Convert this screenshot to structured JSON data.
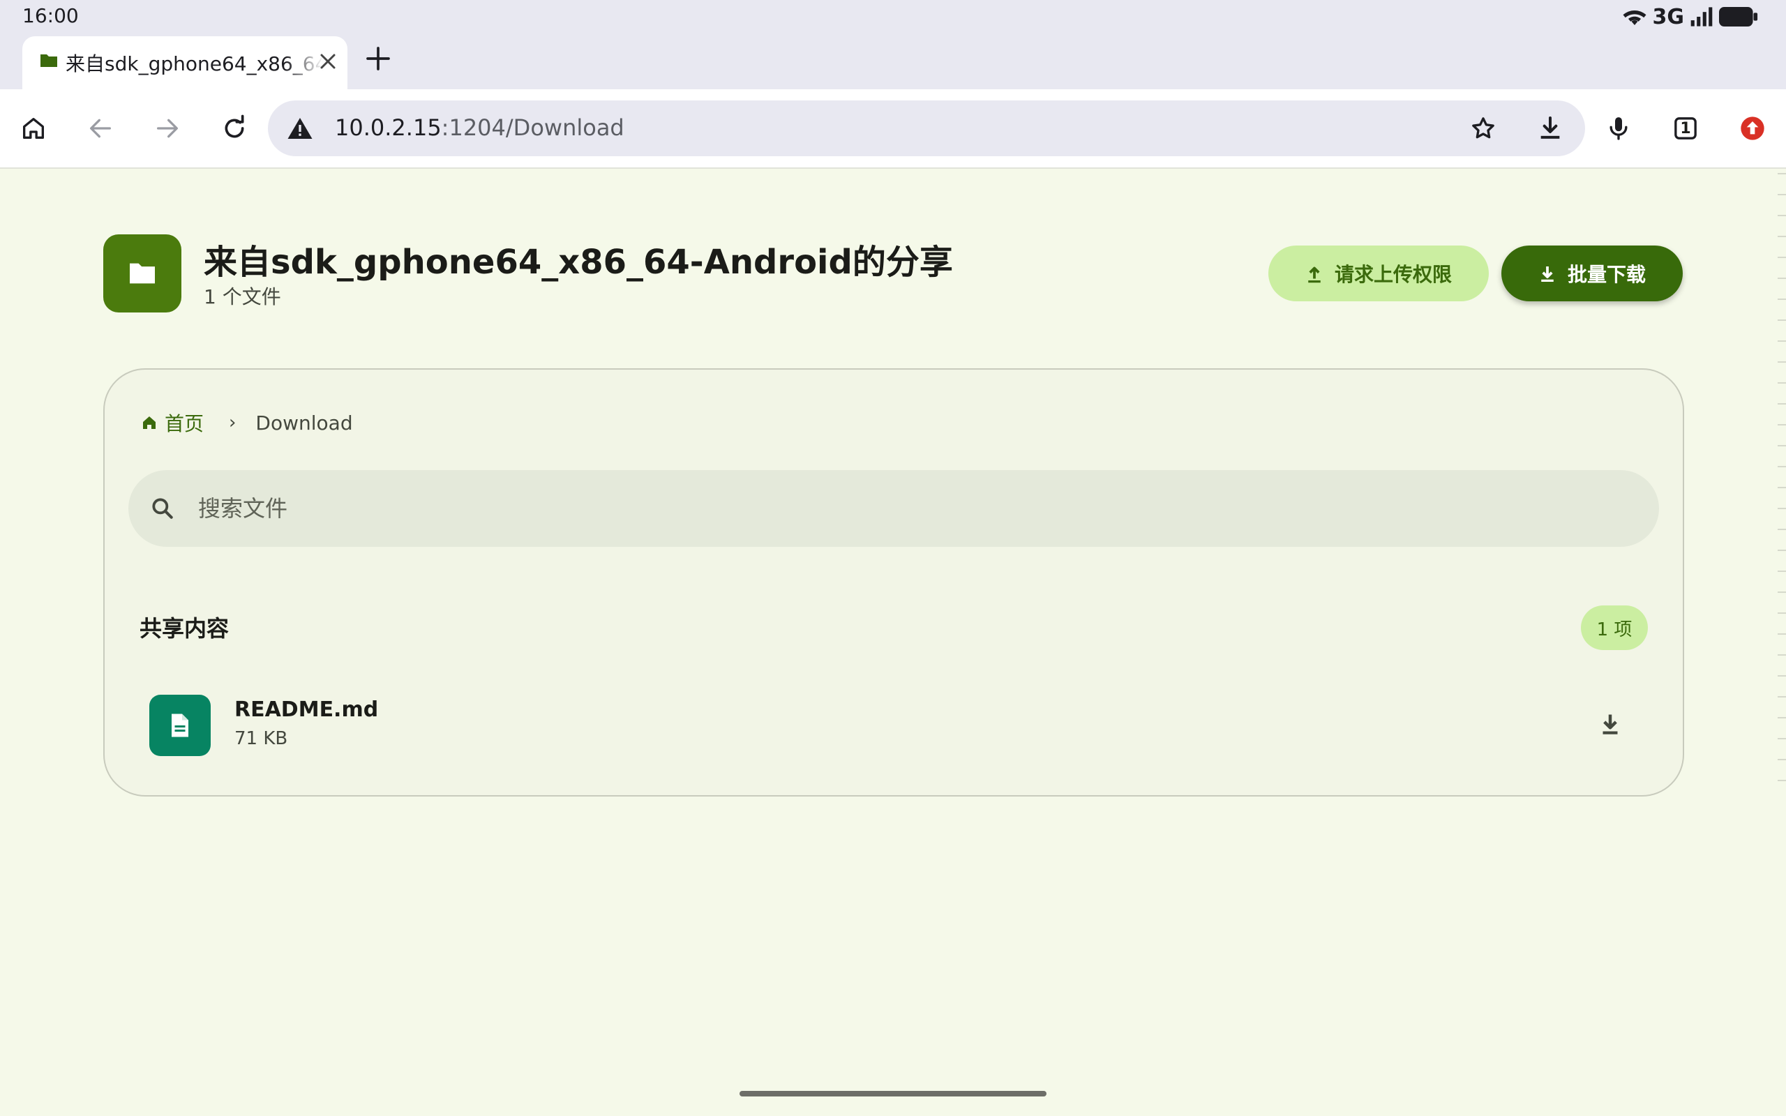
{
  "status_bar": {
    "time": "16:00",
    "network": "3G"
  },
  "tab": {
    "title": "来自sdk_gphone64_x86_64-Android的分享"
  },
  "toolbar": {
    "url_host": "10.0.2.15",
    "url_path": ":1204/Download",
    "tab_count": "1"
  },
  "header": {
    "title": "来自sdk_gphone64_x86_64-Android的分享",
    "subtitle": "1 个文件",
    "request_upload_label": "请求上传权限",
    "batch_download_label": "批量下载"
  },
  "breadcrumb": {
    "home": "首页",
    "separator": "›",
    "current": "Download"
  },
  "search": {
    "placeholder": "搜索文件",
    "value": ""
  },
  "section": {
    "title": "共享内容",
    "count_badge": "1 项"
  },
  "files": [
    {
      "name": "README.md",
      "size": "71 KB"
    }
  ],
  "colors": {
    "page_bg": "#f5f9e9",
    "accent": "#386a0a",
    "accent_container": "#cbeea1",
    "folder_tile": "#4b7b0d",
    "file_tile": "#078462",
    "warning_triangle": "#1d1d22",
    "extension_red": "#d93025"
  },
  "icons": {
    "status": [
      "wifi-icon",
      "signal-icon",
      "battery-icon"
    ],
    "toolbar": [
      "home-icon",
      "back-icon",
      "forward-icon",
      "reload-icon",
      "not-secure-icon",
      "bookmark-star-icon",
      "download-page-icon",
      "mic-icon",
      "tab-switcher-icon",
      "extension-icon"
    ]
  }
}
